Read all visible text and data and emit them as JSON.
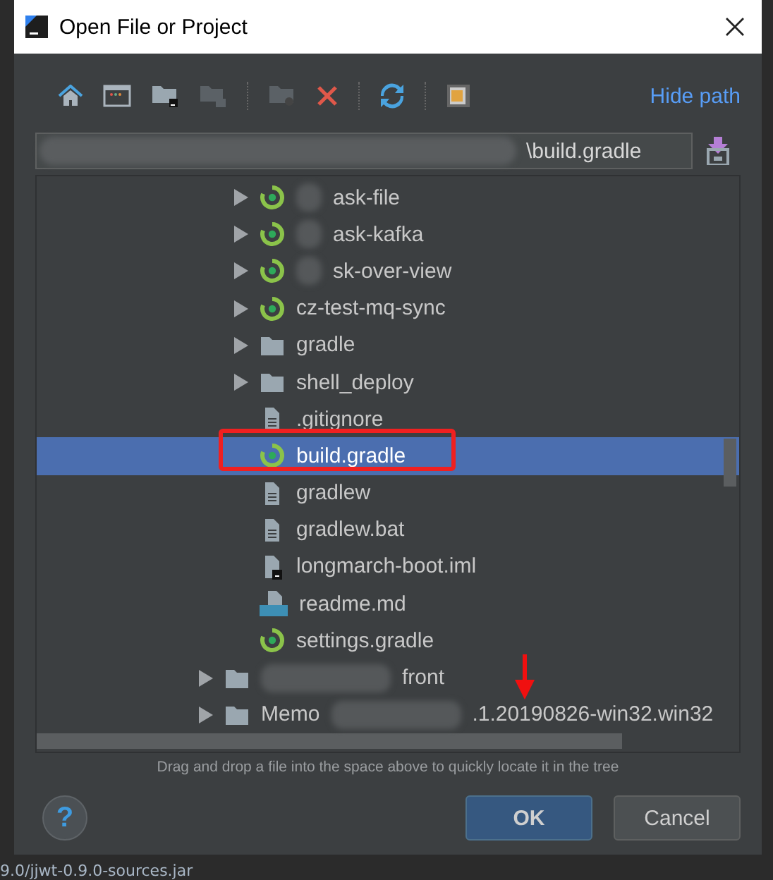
{
  "window": {
    "title": "Open File or Project"
  },
  "toolbar": {
    "link": "Hide path"
  },
  "path_field": {
    "value": "\\build.gradle"
  },
  "tree": {
    "nodes": [
      {
        "children": [
          {
            "label": "ask-file",
            "kind": "module",
            "expanded": false,
            "selected": false,
            "blurred": true
          },
          {
            "label": "ask-kafka",
            "kind": "module",
            "expanded": false,
            "selected": false,
            "blurred": true
          },
          {
            "label": "sk-over-view",
            "kind": "module",
            "expanded": false,
            "selected": false,
            "blurred": true
          },
          {
            "label": "cz-test-mq-sync",
            "kind": "module",
            "expanded": false,
            "selected": false,
            "blurred": false
          },
          {
            "label": "gradle",
            "kind": "folder",
            "expanded": false,
            "selected": false,
            "blurred": false
          },
          {
            "label": "shell_deploy",
            "kind": "folder",
            "expanded": false,
            "selected": false,
            "blurred": false
          },
          {
            "label": ".gitignore",
            "kind": "file",
            "selected": false,
            "blurred": false
          },
          {
            "label": "build.gradle",
            "kind": "gradle",
            "selected": true,
            "blurred": false
          },
          {
            "label": "gradlew",
            "kind": "file",
            "selected": false,
            "blurred": false
          },
          {
            "label": "gradlew.bat",
            "kind": "file",
            "selected": false,
            "blurred": false
          },
          {
            "label": "longmarch-boot.iml",
            "kind": "iml",
            "selected": false,
            "blurred": false
          },
          {
            "label": "readme.md",
            "kind": "markdown",
            "selected": false,
            "blurred": false
          },
          {
            "label": "settings.gradle",
            "kind": "module",
            "selected": false,
            "blurred": false
          }
        ]
      },
      {
        "label": "front",
        "kind": "folder",
        "expanded": false,
        "selected": false,
        "blurred": true
      },
      {
        "label": "Memo",
        "label_tail": ".1.20190826-win32.win32",
        "kind": "folder",
        "expanded": false,
        "selected": false,
        "blurred": true
      }
    ]
  },
  "hint": "Drag and drop a file into the space above to quickly locate it in the tree",
  "help_button": "?",
  "buttons": [
    {
      "label": "OK",
      "kind": "default"
    },
    {
      "label": "Cancel",
      "kind": "normal"
    }
  ],
  "background_text": "9.0/jjwt-0.9.0-sources.jar",
  "annotations": [
    {
      "kind": "box"
    },
    {
      "kind": "arrow"
    }
  ]
}
